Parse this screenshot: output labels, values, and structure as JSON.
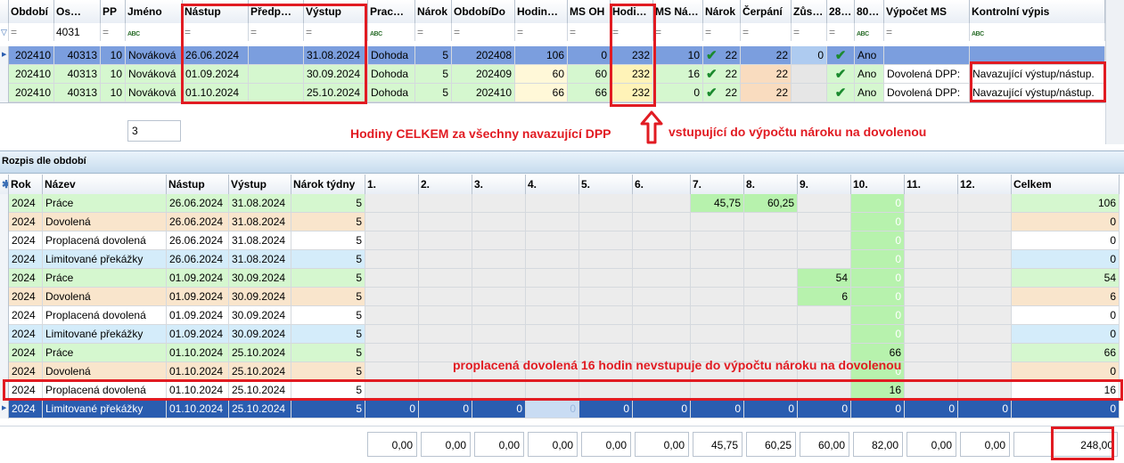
{
  "top_grid": {
    "columns": [
      "Období",
      "Os…",
      "PP",
      "Jméno",
      "Nástup",
      "Předp…",
      "Výstup",
      "Prac…",
      "Nárok",
      "ObdobíDo",
      "Hodin…",
      "MS OH",
      "Hodi…",
      "MS Ná…",
      "Nárok",
      "Čerpání",
      "Zůs…",
      "28…",
      "80…",
      "Výpočet MS",
      "Kontrolní výpis"
    ],
    "filter": {
      "os_value": "4031",
      "abc": "ABC",
      "eq": "="
    },
    "rows": [
      {
        "obdobi": "202410",
        "os": "40313",
        "pp": "10",
        "jmeno": "Nováková",
        "nastup": "26.06.2024",
        "predp": "",
        "vystup": "31.08.2024",
        "prac": "Dohoda",
        "narok": "5",
        "obdobido": "202408",
        "hodin": "106",
        "msoh": "0",
        "hodi": "232",
        "msna": "10",
        "narok2": "22",
        "cerpani": "22",
        "zus": "0",
        "c28": "check",
        "c80": "Ano",
        "vypocet": "",
        "kontrolni": ""
      },
      {
        "obdobi": "202410",
        "os": "40313",
        "pp": "10",
        "jmeno": "Nováková",
        "nastup": "01.09.2024",
        "predp": "",
        "vystup": "30.09.2024",
        "prac": "Dohoda",
        "narok": "5",
        "obdobido": "202409",
        "hodin": "60",
        "msoh": "60",
        "hodi": "232",
        "msna": "16",
        "narok2": "22",
        "cerpani": "22",
        "zus": "",
        "c28": "check",
        "c80": "Ano",
        "vypocet": "Dovolená DPP:",
        "kontrolni": "Navazující výstup/nástup."
      },
      {
        "obdobi": "202410",
        "os": "40313",
        "pp": "10",
        "jmeno": "Nováková",
        "nastup": "01.10.2024",
        "predp": "",
        "vystup": "25.10.2024",
        "prac": "Dohoda",
        "narok": "5",
        "obdobido": "202410",
        "hodin": "66",
        "msoh": "66",
        "hodi": "232",
        "msna": "0",
        "narok2": "22",
        "cerpani": "22",
        "zus": "",
        "c28": "check",
        "c80": "Ano",
        "vypocet": "Dovolená DPP:",
        "kontrolni": "Navazující výstup/nástup."
      }
    ],
    "count": "3"
  },
  "annotations": {
    "hours_total": "Hodiny CELKEM za všechny navazující DPP",
    "entering": "vstupující do výpočtu nároku na dovolenou",
    "paid_leave": "proplacená dovolená 16 hodin nevstupuje do výpočtu  nároku na dovolenou"
  },
  "section_title": "Rozpis dle období",
  "bottom_grid": {
    "columns": [
      "Rok",
      "Název",
      "Nástup",
      "Výstup",
      "Nárok týdny",
      "1.",
      "2.",
      "3.",
      "4.",
      "5.",
      "6.",
      "7.",
      "8.",
      "9.",
      "10.",
      "11.",
      "12.",
      "Celkem"
    ],
    "rows": [
      {
        "rok": "2024",
        "nazev": "Práce",
        "nastup": "26.06.2024",
        "vystup": "31.08.2024",
        "narok": "5",
        "m": [
          "",
          "",
          "",
          "",
          "",
          "",
          "45,75",
          "60,25",
          "",
          "0",
          "",
          ""
        ],
        "celkem": "106",
        "kind": "prace"
      },
      {
        "rok": "2024",
        "nazev": "Dovolená",
        "nastup": "26.06.2024",
        "vystup": "31.08.2024",
        "narok": "5",
        "m": [
          "",
          "",
          "",
          "",
          "",
          "",
          "",
          "",
          "",
          "0",
          "",
          ""
        ],
        "celkem": "0",
        "kind": "dovolena"
      },
      {
        "rok": "2024",
        "nazev": "Proplacená dovolená",
        "nastup": "26.06.2024",
        "vystup": "31.08.2024",
        "narok": "5",
        "m": [
          "",
          "",
          "",
          "",
          "",
          "",
          "",
          "",
          "",
          "0",
          "",
          ""
        ],
        "celkem": "0",
        "kind": "proplacena"
      },
      {
        "rok": "2024",
        "nazev": "Limitované překážky",
        "nastup": "26.06.2024",
        "vystup": "31.08.2024",
        "narok": "5",
        "m": [
          "",
          "",
          "",
          "",
          "",
          "",
          "",
          "",
          "",
          "0",
          "",
          ""
        ],
        "celkem": "0",
        "kind": "limit"
      },
      {
        "rok": "2024",
        "nazev": "Práce",
        "nastup": "01.09.2024",
        "vystup": "30.09.2024",
        "narok": "5",
        "m": [
          "",
          "",
          "",
          "",
          "",
          "",
          "",
          "",
          "54",
          "0",
          "",
          ""
        ],
        "celkem": "54",
        "kind": "prace"
      },
      {
        "rok": "2024",
        "nazev": "Dovolená",
        "nastup": "01.09.2024",
        "vystup": "30.09.2024",
        "narok": "5",
        "m": [
          "",
          "",
          "",
          "",
          "",
          "",
          "",
          "",
          "6",
          "0",
          "",
          ""
        ],
        "celkem": "6",
        "kind": "dovolena"
      },
      {
        "rok": "2024",
        "nazev": "Proplacená dovolená",
        "nastup": "01.09.2024",
        "vystup": "30.09.2024",
        "narok": "5",
        "m": [
          "",
          "",
          "",
          "",
          "",
          "",
          "",
          "",
          "",
          "0",
          "",
          ""
        ],
        "celkem": "0",
        "kind": "proplacena"
      },
      {
        "rok": "2024",
        "nazev": "Limitované překážky",
        "nastup": "01.09.2024",
        "vystup": "30.09.2024",
        "narok": "5",
        "m": [
          "",
          "",
          "",
          "",
          "",
          "",
          "",
          "",
          "",
          "0",
          "",
          ""
        ],
        "celkem": "0",
        "kind": "limit"
      },
      {
        "rok": "2024",
        "nazev": "Práce",
        "nastup": "01.10.2024",
        "vystup": "25.10.2024",
        "narok": "5",
        "m": [
          "",
          "",
          "",
          "",
          "",
          "",
          "",
          "",
          "",
          "66",
          "",
          ""
        ],
        "celkem": "66",
        "kind": "prace"
      },
      {
        "rok": "2024",
        "nazev": "Dovolená",
        "nastup": "01.10.2024",
        "vystup": "25.10.2024",
        "narok": "5",
        "m": [
          "",
          "",
          "",
          "",
          "",
          "",
          "",
          "",
          "",
          "0",
          "",
          ""
        ],
        "celkem": "0",
        "kind": "dovolena"
      },
      {
        "rok": "2024",
        "nazev": "Proplacená dovolená",
        "nastup": "01.10.2024",
        "vystup": "25.10.2024",
        "narok": "5",
        "m": [
          "",
          "",
          "",
          "",
          "",
          "",
          "",
          "",
          "",
          "16",
          "",
          ""
        ],
        "celkem": "16",
        "kind": "proplacena"
      },
      {
        "rok": "2024",
        "nazev": "Limitované překážky",
        "nastup": "01.10.2024",
        "vystup": "25.10.2024",
        "narok": "5",
        "m": [
          "0",
          "0",
          "0",
          "0",
          "0",
          "0",
          "0",
          "0",
          "0",
          "0",
          "0",
          "0"
        ],
        "celkem": "0",
        "kind": "selected"
      }
    ],
    "totals": [
      "0,00",
      "0,00",
      "0,00",
      "0,00",
      "0,00",
      "0,00",
      "45,75",
      "60,25",
      "60,00",
      "82,00",
      "0,00",
      "0,00",
      "248,00"
    ]
  },
  "colors": {
    "accent_red": "#e11b22",
    "selected": "#2a5db0",
    "green": "#c6f5c0",
    "orange": "#f9e3c8",
    "blue": "#cfe9fa",
    "yellow": "#fff6c8",
    "beige": "#fff3dc",
    "salmon": "#f8dcc2"
  }
}
